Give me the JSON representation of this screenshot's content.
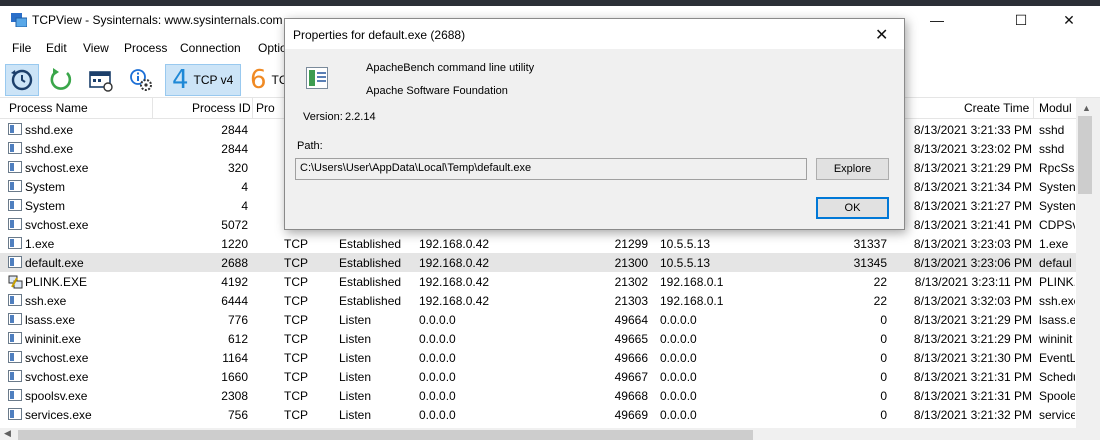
{
  "window": {
    "title": "TCPView - Sysinternals: www.sysinternals.com",
    "min_glyph": "—",
    "max_glyph": "☐",
    "close_glyph": "✕"
  },
  "menu": [
    "File",
    "Edit",
    "View",
    "Process",
    "Connection",
    "Optio"
  ],
  "toolbar": {
    "tcp4_num": "4",
    "tcp4_label": "TCP v4",
    "tcp6_num": "6",
    "tcp6_label": "TC",
    "accent": "#1e88d6",
    "tcp6_color": "#f08a24"
  },
  "columns": {
    "process_name": "Process Name",
    "process_id": "Process ID",
    "protocol": "Pro",
    "create_time": "Create Time",
    "module": "Modul"
  },
  "rows": [
    {
      "name": "sshd.exe",
      "pid": "2844",
      "proto": "",
      "state": "",
      "local": "",
      "lport": "",
      "remote": "",
      "rport": "",
      "time": "8/13/2021 3:21:33 PM",
      "module": "sshd"
    },
    {
      "name": "sshd.exe",
      "pid": "2844",
      "proto": "",
      "state": "",
      "local": "",
      "lport": "",
      "remote": "",
      "rport": "",
      "time": "8/13/2021 3:23:02 PM",
      "module": "sshd"
    },
    {
      "name": "svchost.exe",
      "pid": "320",
      "proto": "",
      "state": "",
      "local": "",
      "lport": "",
      "remote": "",
      "rport": "",
      "time": "8/13/2021 3:21:29 PM",
      "module": "RpcSs"
    },
    {
      "name": "System",
      "pid": "4",
      "proto": "",
      "state": "",
      "local": "",
      "lport": "",
      "remote": "",
      "rport": "",
      "time": "8/13/2021 3:21:34 PM",
      "module": "Systen"
    },
    {
      "name": "System",
      "pid": "4",
      "proto": "",
      "state": "",
      "local": "",
      "lport": "",
      "remote": "",
      "rport": "",
      "time": "8/13/2021 3:21:27 PM",
      "module": "Systen"
    },
    {
      "name": "svchost.exe",
      "pid": "5072",
      "proto": "",
      "state": "",
      "local": "",
      "lport": "",
      "remote": "",
      "rport": "",
      "time": "8/13/2021 3:21:41 PM",
      "module": "CDPSv"
    },
    {
      "name": "1.exe",
      "pid": "1220",
      "proto": "TCP",
      "state": "Established",
      "local": "192.168.0.42",
      "lport": "21299",
      "remote": "10.5.5.13",
      "rport": "31337",
      "time": "8/13/2021 3:23:03 PM",
      "module": "1.exe"
    },
    {
      "name": "default.exe",
      "pid": "2688",
      "proto": "TCP",
      "state": "Established",
      "local": "192.168.0.42",
      "lport": "21300",
      "remote": "10.5.5.13",
      "rport": "31345",
      "time": "8/13/2021 3:23:06 PM",
      "module": "defaul"
    },
    {
      "name": "PLINK.EXE",
      "pid": "4192",
      "proto": "TCP",
      "state": "Established",
      "local": "192.168.0.42",
      "lport": "21302",
      "remote": "192.168.0.1",
      "rport": "22",
      "time": "8/13/2021 3:23:11 PM",
      "module": "PLINK."
    },
    {
      "name": "ssh.exe",
      "pid": "6444",
      "proto": "TCP",
      "state": "Established",
      "local": "192.168.0.42",
      "lport": "21303",
      "remote": "192.168.0.1",
      "rport": "22",
      "time": "8/13/2021 3:32:03 PM",
      "module": "ssh.exe"
    },
    {
      "name": "lsass.exe",
      "pid": "776",
      "proto": "TCP",
      "state": "Listen",
      "local": "0.0.0.0",
      "lport": "49664",
      "remote": "0.0.0.0",
      "rport": "0",
      "time": "8/13/2021 3:21:29 PM",
      "module": "lsass.e"
    },
    {
      "name": "wininit.exe",
      "pid": "612",
      "proto": "TCP",
      "state": "Listen",
      "local": "0.0.0.0",
      "lport": "49665",
      "remote": "0.0.0.0",
      "rport": "0",
      "time": "8/13/2021 3:21:29 PM",
      "module": "wininit"
    },
    {
      "name": "svchost.exe",
      "pid": "1164",
      "proto": "TCP",
      "state": "Listen",
      "local": "0.0.0.0",
      "lport": "49666",
      "remote": "0.0.0.0",
      "rport": "0",
      "time": "8/13/2021 3:21:30 PM",
      "module": "EventL"
    },
    {
      "name": "svchost.exe",
      "pid": "1660",
      "proto": "TCP",
      "state": "Listen",
      "local": "0.0.0.0",
      "lport": "49667",
      "remote": "0.0.0.0",
      "rport": "0",
      "time": "8/13/2021 3:21:31 PM",
      "module": "Schedu"
    },
    {
      "name": "spoolsv.exe",
      "pid": "2308",
      "proto": "TCP",
      "state": "Listen",
      "local": "0.0.0.0",
      "lport": "49668",
      "remote": "0.0.0.0",
      "rport": "0",
      "time": "8/13/2021 3:21:31 PM",
      "module": "Spoole"
    },
    {
      "name": "services.exe",
      "pid": "756",
      "proto": "TCP",
      "state": "Listen",
      "local": "0.0.0.0",
      "lport": "49669",
      "remote": "0.0.0.0",
      "rport": "0",
      "time": "8/13/2021 3:21:32 PM",
      "module": "service"
    }
  ],
  "selected_row": "default.exe",
  "dialog": {
    "title": "Properties for default.exe (2688)",
    "description": "ApacheBench command line utility",
    "company": "Apache Software Foundation",
    "version_label": "Version:",
    "version": "2.2.14",
    "path_label": "Path:",
    "path": "C:\\Users\\User\\AppData\\Local\\Temp\\default.exe",
    "explore_label": "Explore",
    "ok_label": "OK",
    "close_glyph": "✕",
    "focus_color": "#0078d7"
  }
}
